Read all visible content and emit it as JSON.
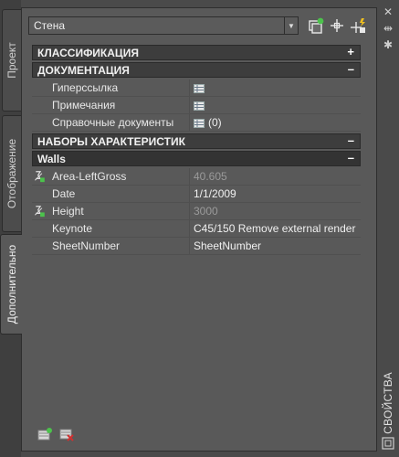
{
  "left_tabs": [
    {
      "label": "Проект"
    },
    {
      "label": "Отображение"
    },
    {
      "label": "Дополнительно"
    }
  ],
  "palette_title": "СВОЙСТВА",
  "selector": {
    "value": "Стена"
  },
  "categories": {
    "classification": {
      "label": "КЛАССИФИКАЦИЯ",
      "toggle": "+"
    },
    "documentation": {
      "label": "ДОКУМЕНТАЦИЯ",
      "toggle": "–"
    },
    "property_sets": {
      "label": "НАБОРЫ ХАРАКТЕРИСТИК",
      "toggle": "–"
    },
    "walls": {
      "label": "Walls",
      "toggle": "–"
    }
  },
  "documentation_rows": [
    {
      "name": "Гиперссылка",
      "value": ""
    },
    {
      "name": "Примечания",
      "value": ""
    },
    {
      "name": "Справочные документы",
      "value": "(0)"
    }
  ],
  "walls_rows": [
    {
      "name": "Area-LeftGross",
      "value": "40.605"
    },
    {
      "name": "Date",
      "value": "1/1/2009"
    },
    {
      "name": "Height",
      "value": "3000"
    },
    {
      "name": "Keynote",
      "value": "C45/150 Remove external render"
    },
    {
      "name": "SheetNumber",
      "value": "SheetNumber"
    }
  ],
  "colors": {
    "panel_bg": "#595959",
    "category_bg": "#3d3d3d",
    "accent_green": "#4cc24c",
    "accent_red": "#d03030"
  }
}
